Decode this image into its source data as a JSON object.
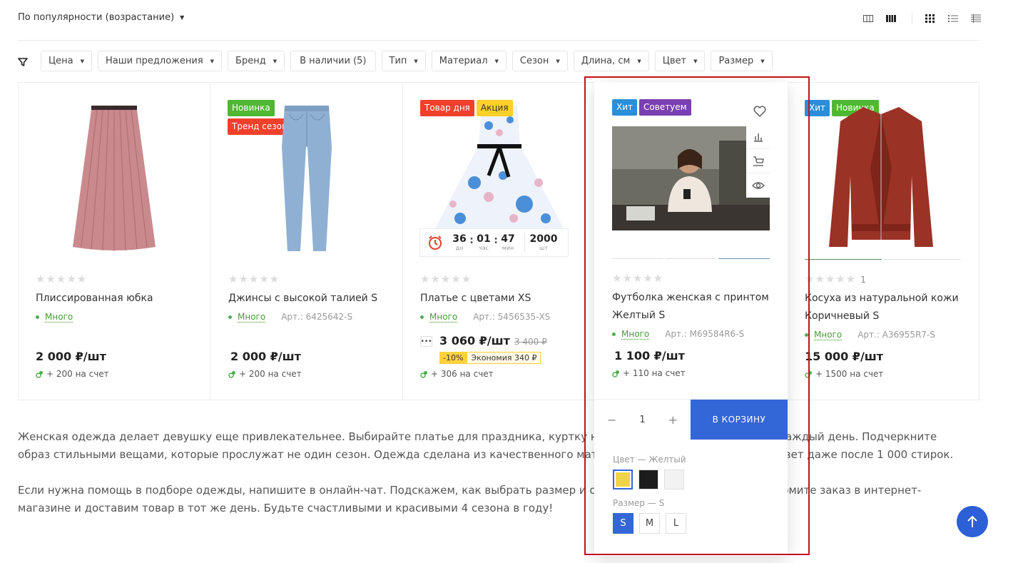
{
  "sort": {
    "label": "По популярности (возрастание)"
  },
  "filters": [
    {
      "label": "Цена",
      "dropdown": true
    },
    {
      "label": "Наши предложения",
      "dropdown": true
    },
    {
      "label": "Бренд",
      "dropdown": true
    },
    {
      "label": "В наличии (5)",
      "dropdown": false
    },
    {
      "label": "Тип",
      "dropdown": true
    },
    {
      "label": "Материал",
      "dropdown": true
    },
    {
      "label": "Сезон",
      "dropdown": true
    },
    {
      "label": "Длина, см",
      "dropdown": true
    },
    {
      "label": "Цвет",
      "dropdown": true
    },
    {
      "label": "Размер",
      "dropdown": true
    }
  ],
  "colors": {
    "accent": "#3366d6",
    "green": "#4caf50",
    "hit": "#2a8ed8",
    "new": "#4fb833",
    "trend": "#f0402a",
    "recommend": "#7a3fb0",
    "deal": "#f0402a",
    "promo": "#ffcf2a",
    "highlight": "#c0121b"
  },
  "products": [
    {
      "name": "Плиссированная юбка",
      "availability": "Много",
      "article": "",
      "price": "2 000 ₽/шт",
      "bonus": "+ 200 на счет",
      "badges": []
    },
    {
      "name": "Джинсы с высокой талией S",
      "availability": "Много",
      "article": "Арт.: 6425642-S",
      "price": "2 000 ₽/шт",
      "bonus": "+ 200 на счет",
      "badges": [
        "Новинка",
        "Тренд сезона"
      ]
    },
    {
      "name": "Платье с цветами XS",
      "availability": "Много",
      "article": "Арт.: 5456535-XS",
      "price": "3 060 ₽/шт",
      "old_price": "3 400 ₽",
      "discount": "-10%",
      "economy": "Экономия 340 ₽",
      "bonus": "+ 306 на счет",
      "badges": [
        "Товар дня",
        "Акция"
      ],
      "timer": {
        "days": "36",
        "days_label": "дн",
        "hours": "01",
        "hours_label": "час",
        "minutes": "47",
        "minutes_label": "мин",
        "stock": "2000",
        "stock_label": "шт"
      }
    },
    {
      "name": "Футболка женская с принтом Желтый S",
      "availability": "Много",
      "article": "Арт.: M69584R6-S",
      "price": "1 100 ₽/шт",
      "bonus": "+ 110 на счет",
      "badges": [
        "Хит",
        "Советуем"
      ],
      "quantity": "1",
      "cart_label": "В КОРЗИНУ",
      "color_label": "Цвет",
      "color_value": "Желтый",
      "size_label": "Размер",
      "size_value": "S",
      "sizes": [
        "S",
        "M",
        "L"
      ],
      "swatches": [
        "#f1d34a",
        "#1c1c1c",
        "#f2f2f2"
      ]
    },
    {
      "name": "Косуха из натуральной кожи Коричневый S",
      "availability": "Много",
      "article": "Арт.: A36955R7-S",
      "price": "15 000 ₽/шт",
      "bonus": "+ 1500 на счет",
      "badges": [
        "Хит",
        "Новинка"
      ],
      "rating_count": "1"
    }
  ],
  "stars": "★★★★★",
  "dash": "—",
  "description": [
    "Женская одежда делает девушку еще привлекательнее. Выбирайте платье для праздника, куртку на весну и осень или джинсы на каждый день. Подчеркните образ стильными вещами, которые прослужат не один сезон. Одежда сделана из качественного материала, поэтому она не теряет цвет даже после 1 000 стирок.",
    "Если нужна помощь в подборе одежды, напишите в онлайн-чат. Подскажем, как выбрать размер и сочетать вещи между собой. Оформите заказ в интернет-магазине и доставим товар в тот же день. Будьте счастливыми и красивыми 4 сезона в году!"
  ]
}
